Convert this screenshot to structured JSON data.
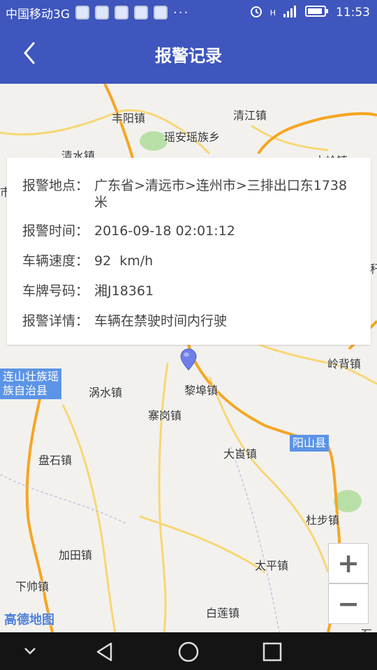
{
  "status_bar": {
    "carrier": "中国移动3G",
    "icons": [
      "shield-app-icon",
      "chrome-icon",
      "qq-icon",
      "chat-icon",
      "weather-icon"
    ],
    "more": "···",
    "network": "H",
    "time": "11:53"
  },
  "header": {
    "title": "报警记录"
  },
  "alarm": {
    "location_label": "报警地点：",
    "location_value": "广东省>清远市>连州市>三排出口东1738米",
    "time_label": "报警时间：",
    "time_value": "2016-09-18 02:01:12",
    "speed_label": "车辆速度：",
    "speed_value": "92  km/h",
    "plate_label": "车牌号码：",
    "plate_value": "湘J18361",
    "detail_label": "报警详情：",
    "detail_value": "车辆在禁驶时间内行驶"
  },
  "map": {
    "labels": {
      "fengyang": "丰阳镇",
      "qingjiang": "清江镇",
      "yaoan": "瑶安瑶族乡",
      "qingshui": "清水镇",
      "shuiling": "水岭镇",
      "lingbei": "岭背镇",
      "woshui": "涡水镇",
      "libu": "黎埠镇",
      "saigang": "寨岗镇",
      "dagen": "大崀镇",
      "panshi": "盘石镇",
      "dubu": "杜步镇",
      "jiatian": "加田镇",
      "taiping": "太平镇",
      "xiashuai": "下帅镇",
      "bailian": "白莲镇",
      "ke": "秆",
      "shi": "市",
      "shihuo": "石"
    },
    "counties": {
      "lianshan": "连山壮族瑶\n族自治县",
      "yangshan": "阳山县"
    },
    "logo": "高德地图",
    "zoom_in": "+",
    "zoom_out": "−",
    "colors": {
      "road_orange": "#f5a623",
      "road_yellow": "#f7d774",
      "green_area": "#b8e0a6",
      "marker": "#6f7fe8",
      "county_label": "#5b94e6"
    }
  }
}
